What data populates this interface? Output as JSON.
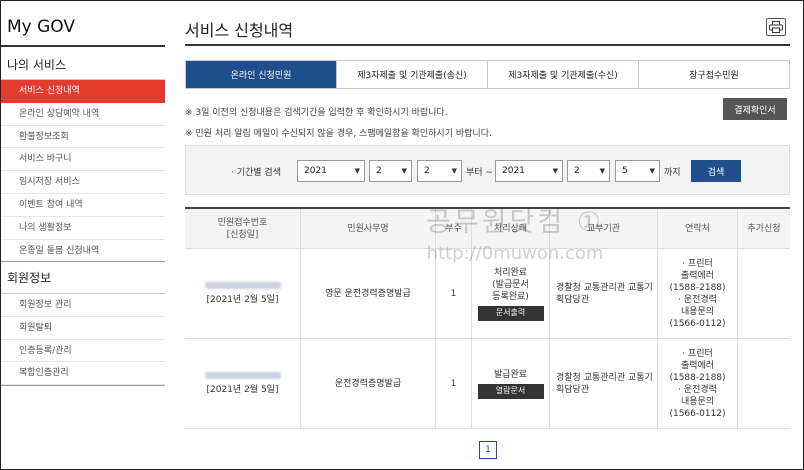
{
  "sidebar": {
    "brand": "My GOV",
    "section1_title": "나의 서비스",
    "section1_items": [
      {
        "label": "서비스 신청내역"
      },
      {
        "label": "온라인 상담예약 내역"
      },
      {
        "label": "환불정보조회"
      },
      {
        "label": "서비스 바구니"
      },
      {
        "label": "임시저장 서비스"
      },
      {
        "label": "이벤트 참여 내역"
      },
      {
        "label": "나의 생활정보"
      },
      {
        "label": "온종일 돌봄 신청내역"
      }
    ],
    "section2_title": "회원정보",
    "section2_items": [
      {
        "label": "회원정보 관리"
      },
      {
        "label": "회원탈퇴"
      },
      {
        "label": "인증등록/관리"
      },
      {
        "label": "복합인증관리"
      }
    ]
  },
  "main": {
    "title": "서비스 신청내역",
    "print_icon": "printer-icon",
    "tabs": [
      {
        "label": "온라인 신청민원",
        "active": true
      },
      {
        "label": "제3자제출 및 기관제출(송신)"
      },
      {
        "label": "제3자제출 및 기관제출(수신)"
      },
      {
        "label": "창구접수민원"
      }
    ],
    "notice1": "※ 3일 이전의 신청내용은 검색기간을 입력한 후 확인하시기 바랍니다.",
    "notice2": "※ 민원 처리 알림 메일이 수신되지 않을 경우, 스팸메일함을 확인하시기 바랍니다.",
    "pay_button": "결제확인서",
    "search": {
      "label": "· 기간별 검색",
      "from_year": "2021",
      "from_month": "2",
      "from_day": "2",
      "from_text": "부터 ~",
      "to_year": "2021",
      "to_month": "2",
      "to_day": "5",
      "to_text": "까지",
      "button": "검색"
    },
    "table": {
      "headers": {
        "receipt_no": "민원접수번호",
        "receipt_date": "[신청일]",
        "affair": "민원사무명",
        "copies": "부수",
        "status": "처리상태",
        "agency": "교부기관",
        "contact": "연락처",
        "extra": "추가신청"
      },
      "rows": [
        {
          "date": "[2021년 2월 5일]",
          "affair": "영문 운전경력증명발급",
          "copies": "1",
          "status_lines": [
            "처리완료",
            "(발급문서",
            "등록완료)"
          ],
          "action": "문서출력",
          "agency": "경찰청 교통관리관 교통기획담당관",
          "contact": [
            "· 프린터",
            "출력에러",
            "(1588-2188)",
            "· 운전경력",
            "내용문의",
            "(1566-0112)"
          ]
        },
        {
          "date": "[2021년 2월 5일]",
          "affair": "운전경력증명발급",
          "copies": "1",
          "status_lines": [
            "발급완료"
          ],
          "action": "열람문서",
          "agency": "경찰청 교통관리관 교통기획담당관",
          "contact": [
            "· 프린터",
            "출력에러",
            "(1588-2188)",
            "· 운전경력",
            "내용문의",
            "(1566-0112)"
          ]
        }
      ]
    },
    "watermark_line1": "공무원닷컴 ①",
    "watermark_line2": "http://0muwon.com",
    "pagination": [
      "1"
    ]
  }
}
